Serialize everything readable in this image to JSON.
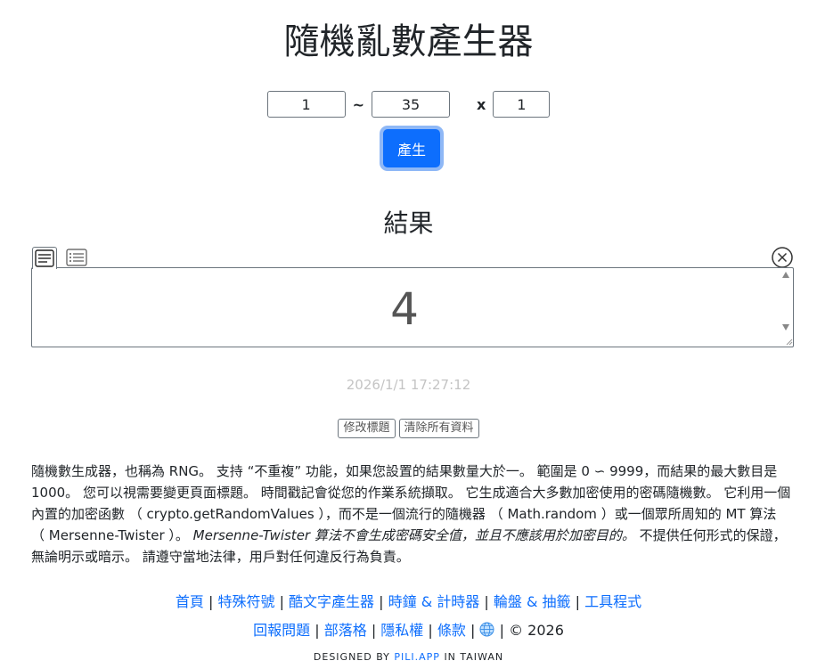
{
  "page": {
    "title": "隨機亂數產生器"
  },
  "generator": {
    "min_value": "1",
    "range_separator": "~",
    "max_value": "35",
    "times_symbol": "x",
    "count_value": "1",
    "generate_label": "產生"
  },
  "result": {
    "title": "結果",
    "tabs": [
      "text-view-icon",
      "list-view-icon"
    ],
    "clear_icon": "close-circle-icon",
    "value": "4",
    "timestamp": "2026/1/1 17:27:12"
  },
  "actions": {
    "edit_title_label": "修改標題",
    "clear_all_label": "清除所有資料"
  },
  "description": {
    "part1": "隨機數生成器，也稱為 RNG。 支持 “不重複” 功能，如果您設置的結果數量大於一。 範圍是 0 ∽ 9999，而結果的最大數目是 1000。 您可以視需要變更頁面標題。 時間戳記會從您的作業系統擷取。 它生成適合大多數加密使用的密碼隨機數。 它利用一個內置的加密函數 （ crypto.getRandomValues ），而不是一個流行的隨機器 （ Math.random ）或一個眾所周知的 MT 算法 （ Mersenne-Twister ）。 ",
    "italic": "Mersenne-Twister 算法不會生成密碼安全值，並且不應該用於加密目的。",
    "part2": " 不提供任何形式的保證，無論明示或暗示。 請遵守當地法律，用戶對任何違反行為負責。"
  },
  "footer": {
    "links_row1": [
      "首頁",
      "特殊符號",
      "酷文字產生器",
      "時鐘 & 計時器",
      "輪盤 & 抽籤",
      "工具程式"
    ],
    "links_row2": [
      "回報問題",
      "部落格",
      "隱私權",
      "條款"
    ],
    "separator": "|",
    "globe_icon": "globe-icon",
    "copyright": "© 2026",
    "designed_prefix": "DESIGNED BY",
    "designed_brand": "PILI.APP",
    "designed_suffix": "IN TAIWAN"
  },
  "colors": {
    "primary": "#0d6efd",
    "timestamp": "#c4c4c4",
    "text": "#212529"
  }
}
